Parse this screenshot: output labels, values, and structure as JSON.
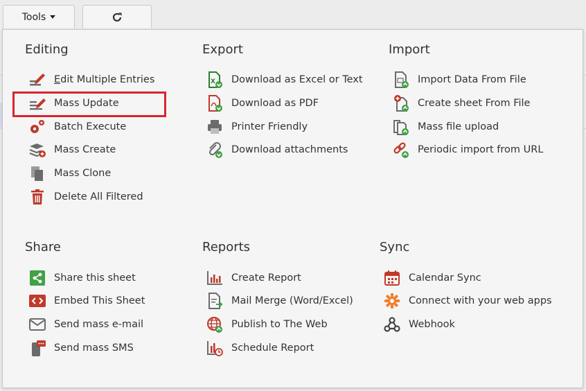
{
  "toolbar": {
    "tools_label": "Tools"
  },
  "sections": {
    "editing": {
      "title": "Editing",
      "items": [
        {
          "label": "Edit Multiple Entries"
        },
        {
          "label": "Mass Update"
        },
        {
          "label": "Batch Execute"
        },
        {
          "label": "Mass Create"
        },
        {
          "label": "Mass Clone"
        },
        {
          "label": "Delete All Filtered"
        }
      ]
    },
    "export": {
      "title": "Export",
      "items": [
        {
          "label": "Download as Excel or Text"
        },
        {
          "label": "Download as PDF"
        },
        {
          "label": "Printer Friendly"
        },
        {
          "label": "Download attachments"
        }
      ]
    },
    "import": {
      "title": "Import",
      "items": [
        {
          "label": "Import Data From File"
        },
        {
          "label": "Create sheet From File"
        },
        {
          "label": "Mass file upload"
        },
        {
          "label": "Periodic import from URL"
        }
      ]
    },
    "share": {
      "title": "Share",
      "items": [
        {
          "label": "Share this sheet"
        },
        {
          "label": "Embed This Sheet"
        },
        {
          "label": "Send mass e-mail"
        },
        {
          "label": "Send mass SMS"
        }
      ]
    },
    "reports": {
      "title": "Reports",
      "items": [
        {
          "label": "Create Report"
        },
        {
          "label": "Mail Merge (Word/Excel)"
        },
        {
          "label": "Publish to The Web"
        },
        {
          "label": "Schedule Report"
        }
      ]
    },
    "sync": {
      "title": "Sync",
      "items": [
        {
          "label": "Calendar Sync"
        },
        {
          "label": "Connect with your web apps"
        },
        {
          "label": "Webhook"
        }
      ]
    }
  },
  "colors": {
    "highlight": "#d9242f",
    "red": "#c0392b",
    "green": "#43a047",
    "gray": "#6b6b6b",
    "orange": "#f07f2b"
  }
}
